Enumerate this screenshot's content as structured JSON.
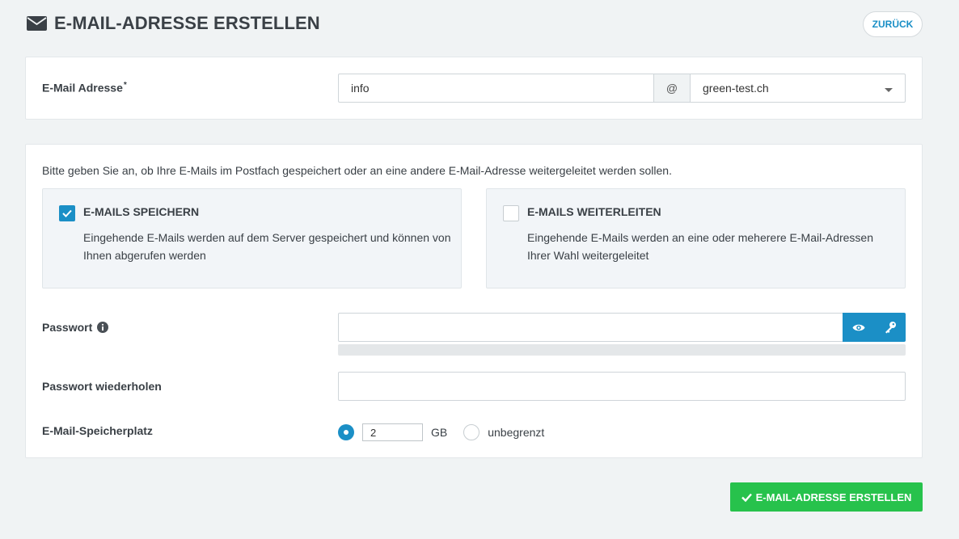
{
  "header": {
    "title": "E-MAIL-ADRESSE ERSTELLEN",
    "back_label": "ZURÜCK",
    "icon": "envelope-icon"
  },
  "email": {
    "label": "E-Mail Adresse",
    "required_mark": "*",
    "local_value": "info",
    "at": "@",
    "domain_value": "green-test.ch"
  },
  "delivery": {
    "intro": "Bitte geben Sie an, ob Ihre E-Mails im Postfach gespeichert oder an eine andere E-Mail-Adresse weitergeleitet werden sollen.",
    "options": [
      {
        "title": "E-MAILS SPEICHERN",
        "description": "Eingehende E-Mails werden auf dem Server gespeichert und können von Ihnen abgerufen werden",
        "checked": true
      },
      {
        "title": "E-MAILS WEITERLEITEN",
        "description": "Eingehende E-Mails werden an eine oder meherere E-Mail-Adressen Ihrer Wahl weitergeleitet",
        "checked": false
      }
    ]
  },
  "password": {
    "label": "Passwort",
    "info_icon": "info-circle-icon",
    "value": "",
    "strength": 0,
    "repeat_label": "Passwort wiederholen",
    "repeat_value": ""
  },
  "storage": {
    "label": "E-Mail-Speicherplatz",
    "size_value": "2",
    "unit": "GB",
    "unlimited_label": "unbegrenzt",
    "selected": "size"
  },
  "submit": {
    "label": "E-MAIL-ADRESSE ERSTELLEN"
  },
  "colors": {
    "accent": "#1b8fc6",
    "success": "#27c24c",
    "background": "#f0f3f4"
  }
}
